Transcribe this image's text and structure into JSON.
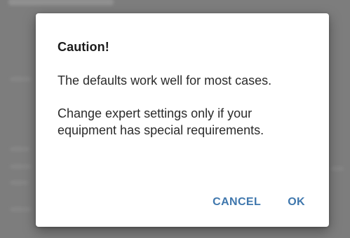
{
  "dialog": {
    "title": "Caution!",
    "paragraph1": "The defaults work well for most cases.",
    "paragraph2": "Change expert settings only if your equipment has special requirements.",
    "buttons": {
      "cancel": "CANCEL",
      "ok": "OK"
    }
  },
  "colors": {
    "accent": "#3f77ad",
    "scrim": "#7d7d7d",
    "dialog_background": "#ffffff"
  }
}
